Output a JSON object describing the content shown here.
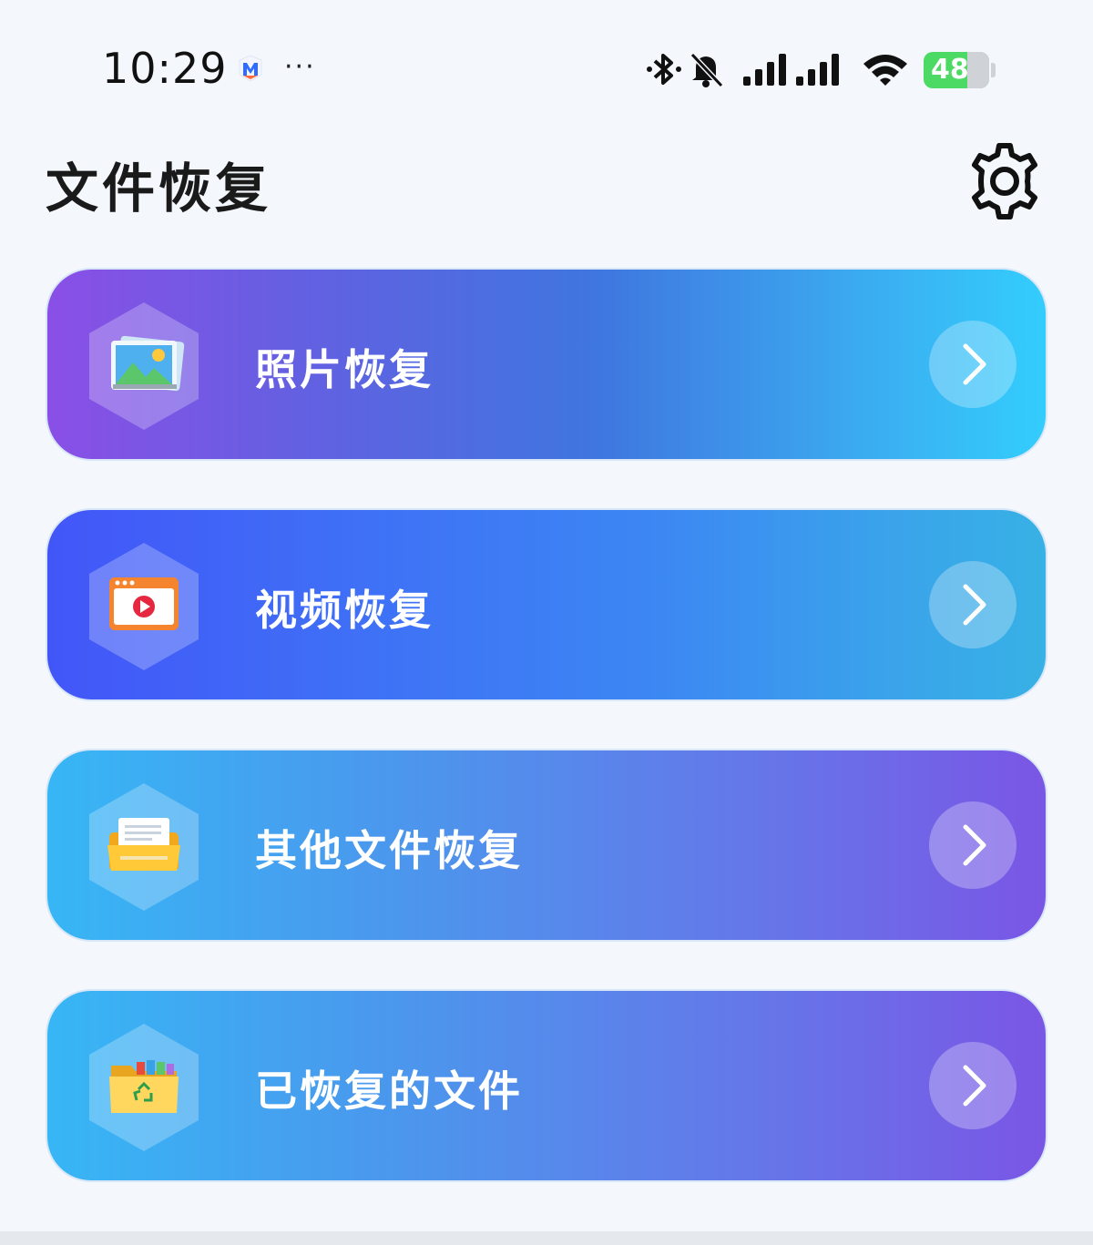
{
  "status_bar": {
    "time": "10:29",
    "more": "···",
    "battery_level": "48",
    "battery_charging": true,
    "icons": [
      "app-notification-icon",
      "bluetooth-icon",
      "silent-bell-icon",
      "cellular-signal-icon",
      "cellular-signal-icon",
      "wifi-icon",
      "battery-icon"
    ]
  },
  "header": {
    "title": "文件恢复",
    "settings_icon": "gear-icon"
  },
  "cards": [
    {
      "label": "照片恢复",
      "icon": "photo-icon",
      "action_icon": "chevron-right-icon"
    },
    {
      "label": "视频恢复",
      "icon": "video-icon",
      "action_icon": "chevron-right-icon"
    },
    {
      "label": "其他文件恢复",
      "icon": "document-folder-icon",
      "action_icon": "chevron-right-icon"
    },
    {
      "label": "已恢复的文件",
      "icon": "recycle-folder-icon",
      "action_icon": "chevron-right-icon"
    }
  ],
  "colors": {
    "background": "#f4f8fd",
    "battery": "#4cd964",
    "text": "#1a1a1a"
  }
}
